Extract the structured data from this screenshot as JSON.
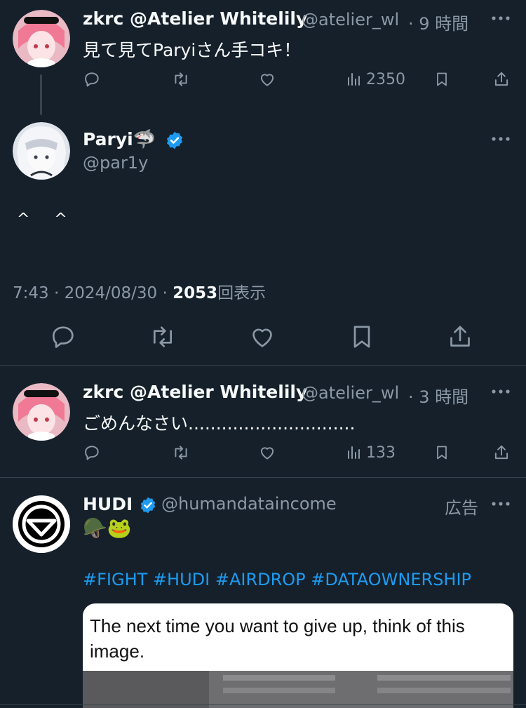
{
  "tweet1": {
    "name": "zkrc @Atelier Whitelily",
    "handle": "@atelier_wl",
    "time": "· 9 時間",
    "text": "見て見てParyiさん手コキ！",
    "views": "2350"
  },
  "main_tweet": {
    "name": "Paryi",
    "emoji": "🦈",
    "handle": "@par1y",
    "text": "^ ^",
    "meta_time": "7:43 · 2024/08/30 ·",
    "meta_views_count": "2053",
    "meta_views_label": "回表示"
  },
  "tweet2": {
    "name": "zkrc @Atelier Whitelily",
    "handle": "@atelier_wl",
    "time": "· 3 時間",
    "text": "ごめんなさい..............................",
    "views": "133"
  },
  "ad": {
    "name": "HUDI",
    "handle": "@humandataincome",
    "label": "広告",
    "emojis": "🪖🐸",
    "hashtags": "#FIGHT #HUDI #AIRDROP #DATAOWNERSHIP",
    "card_text": "The next time you want to give up, think of this image."
  },
  "icons": {
    "more": "more-icon",
    "reply": "reply-icon",
    "retweet": "retweet-icon",
    "like": "heart-icon",
    "views": "views-icon",
    "bookmark": "bookmark-icon",
    "share": "share-icon",
    "verified": "verified-icon"
  },
  "colors": {
    "background": "#15202b",
    "accent": "#1d9bf0",
    "muted": "#8b98a5",
    "divider": "#38444d"
  }
}
